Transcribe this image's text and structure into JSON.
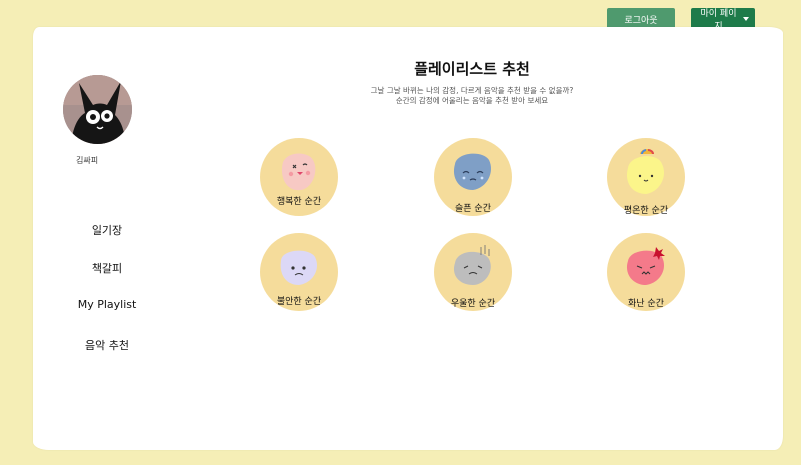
{
  "header": {
    "logout_label": "로그아웃",
    "mypage_label": "마이 페이지"
  },
  "profile": {
    "username": "김싸피"
  },
  "sidebar": {
    "items": [
      {
        "label": "일기장"
      },
      {
        "label": "책갈피"
      },
      {
        "label": "My Playlist"
      },
      {
        "label": "음악 추천"
      }
    ]
  },
  "main": {
    "title": "플레이리스트 추천",
    "subtitle_line1": "그날 그날 바뀌는 나의 감정, 다르게 음악을 추천 받을 수 없을까?",
    "subtitle_line2": "순간의 감정에 어울리는 음악을 추천 받아 보세요",
    "moods": [
      {
        "label": "행복한 순간",
        "color": "#f7c9c4"
      },
      {
        "label": "슬픈 순간",
        "color": "#7f9fc6"
      },
      {
        "label": "평온한 순간",
        "color": "#fbf58a"
      },
      {
        "label": "불안한 순간",
        "color": "#dcd8f6"
      },
      {
        "label": "우울한 순간",
        "color": "#bdbdbd"
      },
      {
        "label": "화난 순간",
        "color": "#f47a8a"
      }
    ]
  },
  "colors": {
    "background": "#f5eeb6",
    "circle": "#f5dc9b",
    "logout_button": "#4f9a6e",
    "mypage_button": "#1e7b4a"
  }
}
